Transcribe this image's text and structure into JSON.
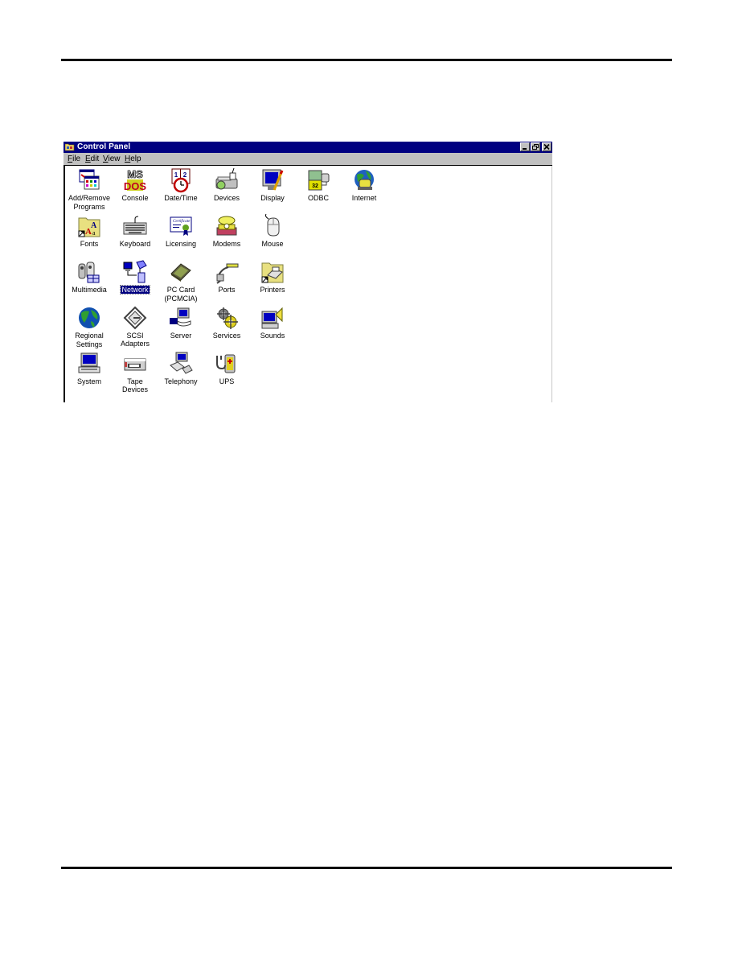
{
  "window": {
    "title": "Control Panel",
    "title_icon": "control-panel-folder-icon",
    "controls": [
      {
        "name": "minimize",
        "glyph": "_"
      },
      {
        "name": "maximize",
        "glyph": "□"
      },
      {
        "name": "close",
        "glyph": "×"
      }
    ],
    "menu": [
      {
        "label": "File",
        "accel": "F"
      },
      {
        "label": "Edit",
        "accel": "E"
      },
      {
        "label": "View",
        "accel": "V"
      },
      {
        "label": "Help",
        "accel": "H"
      }
    ],
    "selected_item": "Network",
    "items": [
      {
        "label": "Add/Remove Programs",
        "line1": "Add/Remove",
        "line2": "Programs",
        "icon": "add-remove-programs-icon"
      },
      {
        "label": "Console",
        "line1": "Console",
        "line2": "",
        "icon": "console-msdos-icon"
      },
      {
        "label": "Date/Time",
        "line1": "Date/Time",
        "line2": "",
        "icon": "date-time-icon"
      },
      {
        "label": "Devices",
        "line1": "Devices",
        "line2": "",
        "icon": "devices-icon"
      },
      {
        "label": "Display",
        "line1": "Display",
        "line2": "",
        "icon": "display-icon"
      },
      {
        "label": "ODBC",
        "line1": "ODBC",
        "line2": "",
        "icon": "odbc-icon"
      },
      {
        "label": "Internet",
        "line1": "Internet",
        "line2": "",
        "icon": "internet-icon"
      },
      {
        "label": "Fonts",
        "line1": "Fonts",
        "line2": "",
        "icon": "fonts-folder-icon"
      },
      {
        "label": "Keyboard",
        "line1": "Keyboard",
        "line2": "",
        "icon": "keyboard-icon"
      },
      {
        "label": "Licensing",
        "line1": "Licensing",
        "line2": "",
        "icon": "licensing-certificate-icon"
      },
      {
        "label": "Modems",
        "line1": "Modems",
        "line2": "",
        "icon": "modem-phone-icon"
      },
      {
        "label": "Mouse",
        "line1": "Mouse",
        "line2": "",
        "icon": "mouse-icon"
      },
      {
        "label": "Multimedia",
        "line1": "Multimedia",
        "line2": "",
        "icon": "multimedia-icon"
      },
      {
        "label": "Network",
        "line1": "Network",
        "line2": "",
        "icon": "network-icon"
      },
      {
        "label": "PC Card (PCMCIA)",
        "line1": "PC Card",
        "line2": "(PCMCIA)",
        "icon": "pc-card-icon"
      },
      {
        "label": "Ports",
        "line1": "Ports",
        "line2": "",
        "icon": "ports-icon"
      },
      {
        "label": "Printers",
        "line1": "Printers",
        "line2": "",
        "icon": "printers-folder-icon"
      },
      {
        "label": "Regional Settings",
        "line1": "Regional",
        "line2": "Settings",
        "icon": "globe-icon"
      },
      {
        "label": "SCSI Adapters",
        "line1": "SCSI Adapters",
        "line2": "",
        "icon": "scsi-adapter-icon"
      },
      {
        "label": "Server",
        "line1": "Server",
        "line2": "",
        "icon": "server-icon"
      },
      {
        "label": "Services",
        "line1": "Services",
        "line2": "",
        "icon": "services-gears-icon"
      },
      {
        "label": "Sounds",
        "line1": "Sounds",
        "line2": "",
        "icon": "sounds-speaker-icon"
      },
      {
        "label": "System",
        "line1": "System",
        "line2": "",
        "icon": "system-computer-icon"
      },
      {
        "label": "Tape Devices",
        "line1": "Tape Devices",
        "line2": "",
        "icon": "tape-drive-icon"
      },
      {
        "label": "Telephony",
        "line1": "Telephony",
        "line2": "",
        "icon": "telephony-icon"
      },
      {
        "label": "UPS",
        "line1": "UPS",
        "line2": "",
        "icon": "ups-battery-icon"
      }
    ]
  },
  "colors": {
    "titlebar": "#000080",
    "menubar": "#c0c0c0",
    "selection": "#000080"
  }
}
